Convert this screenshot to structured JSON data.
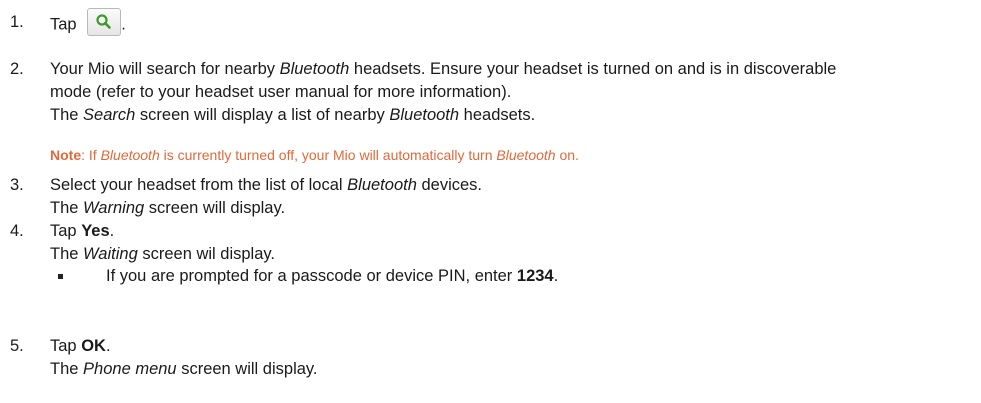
{
  "steps": [
    {
      "num": "1.",
      "text_a": "Tap ",
      "text_b": "."
    },
    {
      "num": "2.",
      "line1_a": "Your Mio will search for nearby ",
      "line1_i": "Bluetooth",
      "line1_b": " headsets. Ensure your headset is turned on and is in discoverable",
      "line2": "mode (refer to your headset user manual for more information).",
      "line3_a": "The ",
      "line3_i1": "Search",
      "line3_b": " screen will display a list of nearby ",
      "line3_i2": "Bluetooth",
      "line3_c": " headsets."
    },
    {
      "num": "3.",
      "line1_a": "Select your headset from the list of local ",
      "line1_i": "Bluetooth",
      "line1_b": " devices.",
      "line2_a": "The ",
      "line2_i": "Warning",
      "line2_b": " screen will display."
    },
    {
      "num": "4.",
      "line1_a": "Tap ",
      "line1_bold": "Yes",
      "line1_b": ".",
      "line2_a": "The ",
      "line2_i": "Waiting",
      "line2_b": " screen wil display."
    },
    {
      "num": "5.",
      "line1_a": "Tap ",
      "line1_bold": "OK",
      "line1_b": ".",
      "line2_a": "The ",
      "line2_i": "Phone menu",
      "line2_b": " screen will display."
    }
  ],
  "note": {
    "label": "Note",
    "a": ": If ",
    "i1": "Bluetooth",
    "b": " is currently turned off, your Mio will automatically turn ",
    "i2": "Bluetooth",
    "c": " on."
  },
  "bullet": {
    "a": "If you are prompted for a passcode or device PIN, enter ",
    "bold": "1234",
    "b": "."
  },
  "icons": {
    "search_button": "search-icon"
  },
  "colors": {
    "note": "#e0693a",
    "icon_green": "#3f9a2d"
  }
}
